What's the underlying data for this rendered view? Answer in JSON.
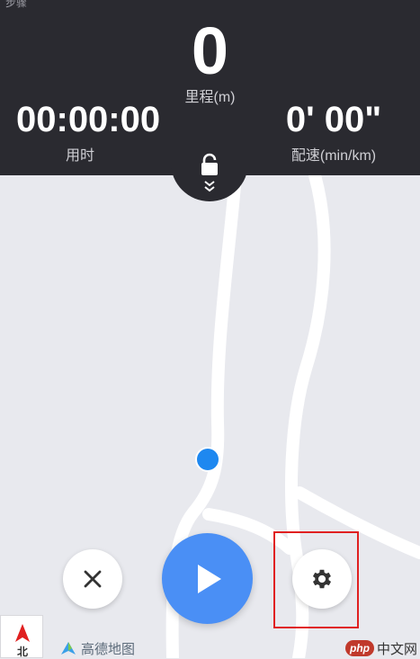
{
  "status": {
    "text": "步骤"
  },
  "stats": {
    "distance_value": "0",
    "distance_label": "里程(m)",
    "time_value": "00:00:00",
    "time_label": "用时",
    "pace_value": "0' 00\"",
    "pace_label": "配速(min/km)"
  },
  "compass": {
    "label": "北"
  },
  "map_logo": {
    "text": "高德地图"
  },
  "watermark": {
    "badge": "php",
    "text": "中文网"
  },
  "colors": {
    "panel": "#2a2a30",
    "map_background": "#e8e9ee",
    "road": "#ffffff",
    "play_button": "#4a8ff5",
    "location_dot": "#1e88f0",
    "highlight": "#e02020"
  },
  "icons": {
    "lock": "lock-icon",
    "collapse": "double-chevron-down-icon",
    "cancel": "close-icon",
    "play": "play-icon",
    "settings": "gear-icon",
    "compass": "north-arrow-icon"
  }
}
